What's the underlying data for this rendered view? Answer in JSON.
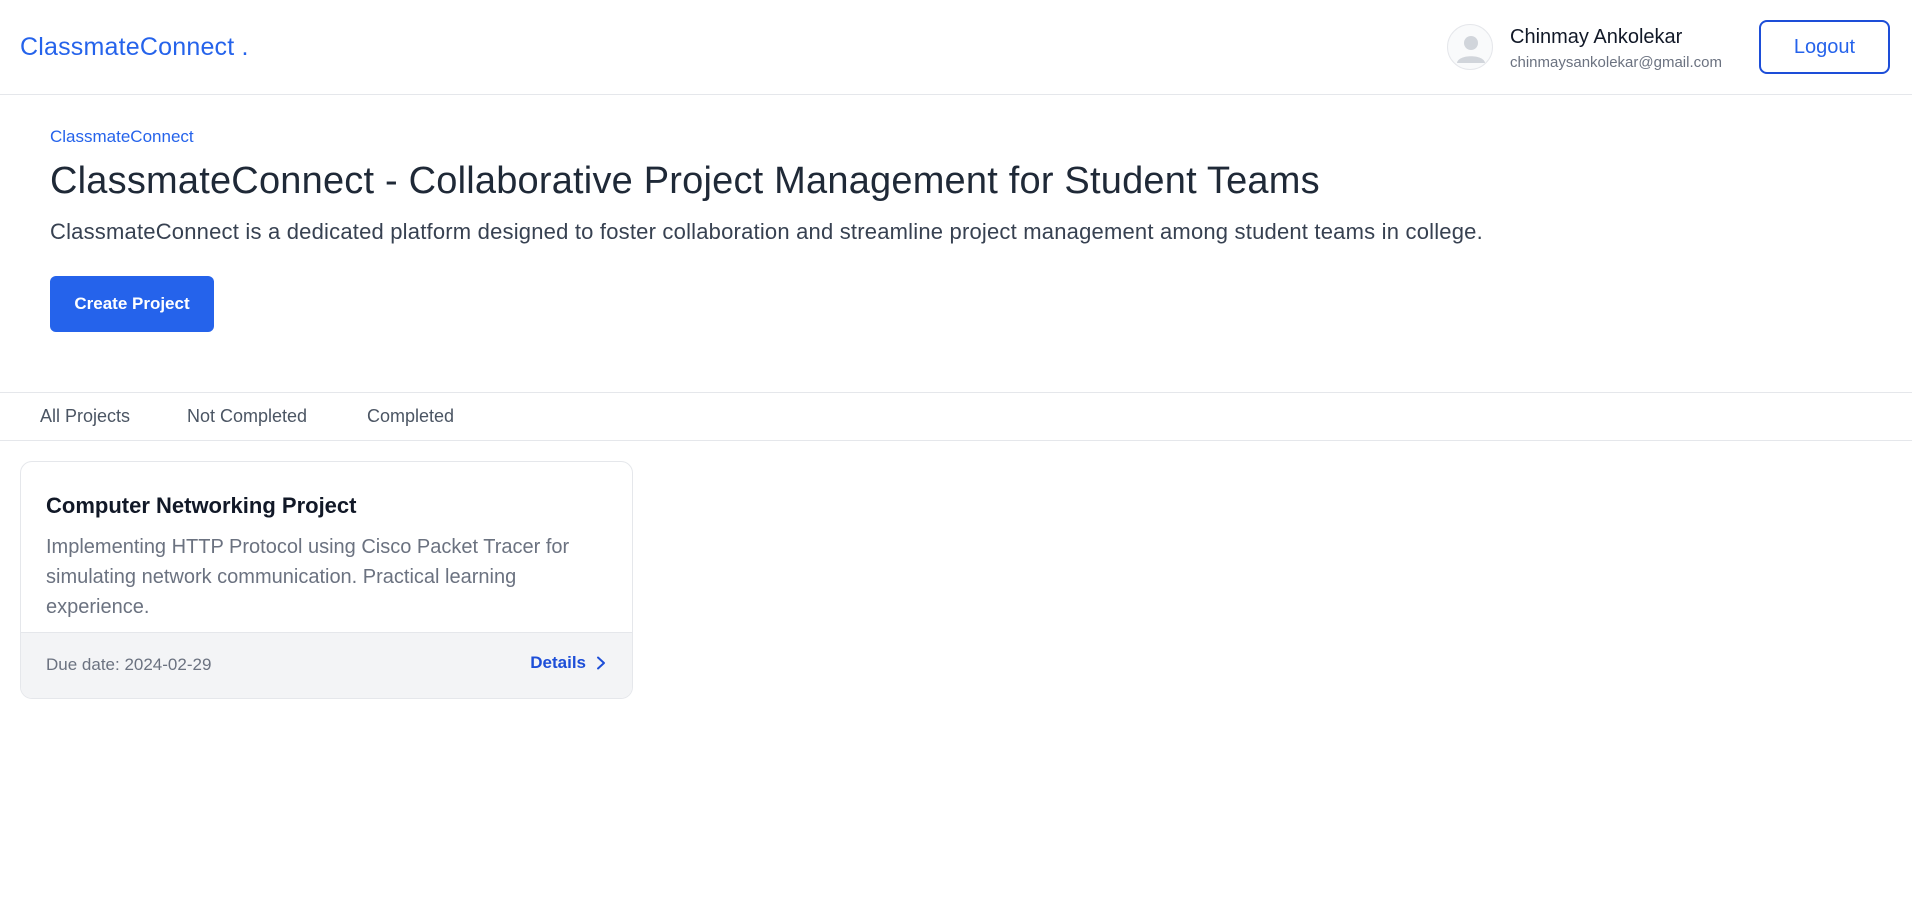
{
  "header": {
    "brand": "ClassmateConnect .",
    "user_name": "Chinmay Ankolekar",
    "user_email": "chinmaysankolekar@gmail.com",
    "logout_label": "Logout"
  },
  "hero": {
    "eyebrow": "ClassmateConnect",
    "title": "ClassmateConnect - Collaborative Project Management for Student Teams",
    "description": "ClassmateConnect is a dedicated platform designed to foster collaboration and streamline project management among student teams in college.",
    "create_label": "Create Project"
  },
  "tabs": [
    {
      "label": "All Projects"
    },
    {
      "label": "Not Completed"
    },
    {
      "label": "Completed"
    }
  ],
  "projects": [
    {
      "title": "Computer Networking Project",
      "description": "Implementing HTTP Protocol using Cisco Packet Tracer for simulating network communication. Practical learning experience.",
      "due": "Due date: 2024-02-29",
      "details_label": "Details"
    }
  ],
  "icons": {
    "avatar": "user-avatar-icon",
    "details": "chevron-right-icon"
  },
  "colors": {
    "accent": "#2563eb",
    "text": "#1f2937",
    "muted": "#6b7280",
    "footer_bg": "#f3f4f6"
  }
}
